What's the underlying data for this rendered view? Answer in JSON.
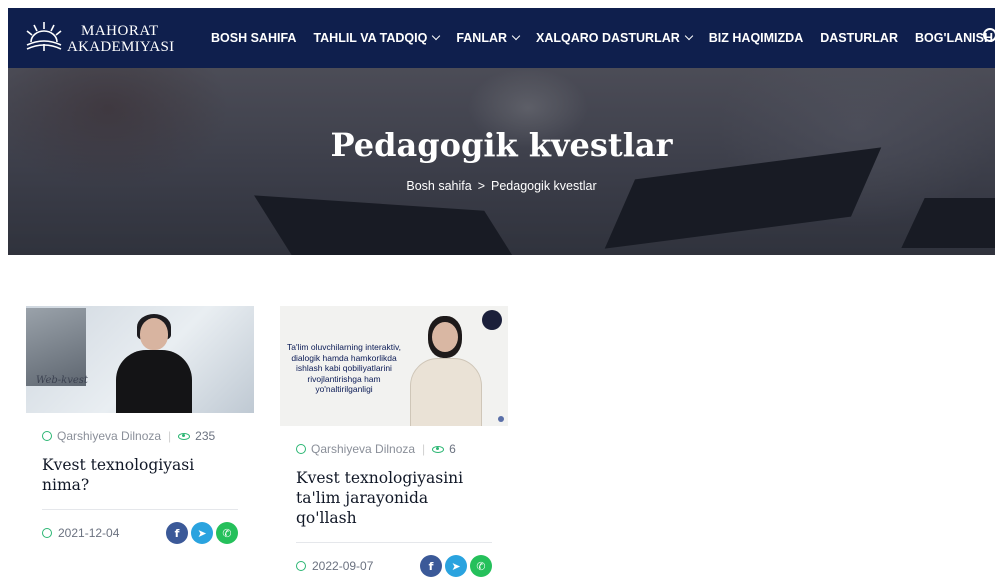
{
  "header": {
    "logo_line1": "MAHORAT",
    "logo_line2": "AKADEMIYASI",
    "nav": [
      {
        "label": "BOSH SAHIFA",
        "dropdown": false
      },
      {
        "label": "TAHLIL VA TADQIQ",
        "dropdown": true
      },
      {
        "label": "FANLAR",
        "dropdown": true
      },
      {
        "label": "XALQARO DASTURLAR",
        "dropdown": true
      },
      {
        "label": "BIZ HAQIMIZDA",
        "dropdown": false
      },
      {
        "label": "DASTURLAR",
        "dropdown": false
      },
      {
        "label": "BOG'LANISH",
        "dropdown": false
      }
    ],
    "search_icon": "search-icon"
  },
  "hero": {
    "title": "Pedagogik kvestlar",
    "breadcrumb": {
      "home": "Bosh sahifa",
      "separator": ">",
      "current": "Pedagogik kvestlar"
    }
  },
  "posts": [
    {
      "thumb_text": "Web-kvest",
      "author": "Qarshiyeva Dilnoza",
      "views": "235",
      "title": "Kvest texnologiyasi nima?",
      "date": "2021-12-04"
    },
    {
      "thumb_text": "Ta'lim oluvchilarning interaktiv, dialogik hamda hamkorlikda ishlash kabi qobiliyatlarini rivojlantirishga ham yo'naltirilganligi",
      "author": "Qarshiyeva Dilnoza",
      "views": "6",
      "title": "Kvest texnologiyasini ta'lim jarayonida qo'llash",
      "date": "2022-09-07"
    }
  ],
  "share_labels": {
    "facebook": "f",
    "telegram": "➤",
    "whatsapp": "✆"
  },
  "colors": {
    "header_bg": "#0f1f4d",
    "accent_green": "#2bb673",
    "facebook": "#3b5998",
    "telegram": "#2aa3df",
    "whatsapp": "#25c05b"
  }
}
